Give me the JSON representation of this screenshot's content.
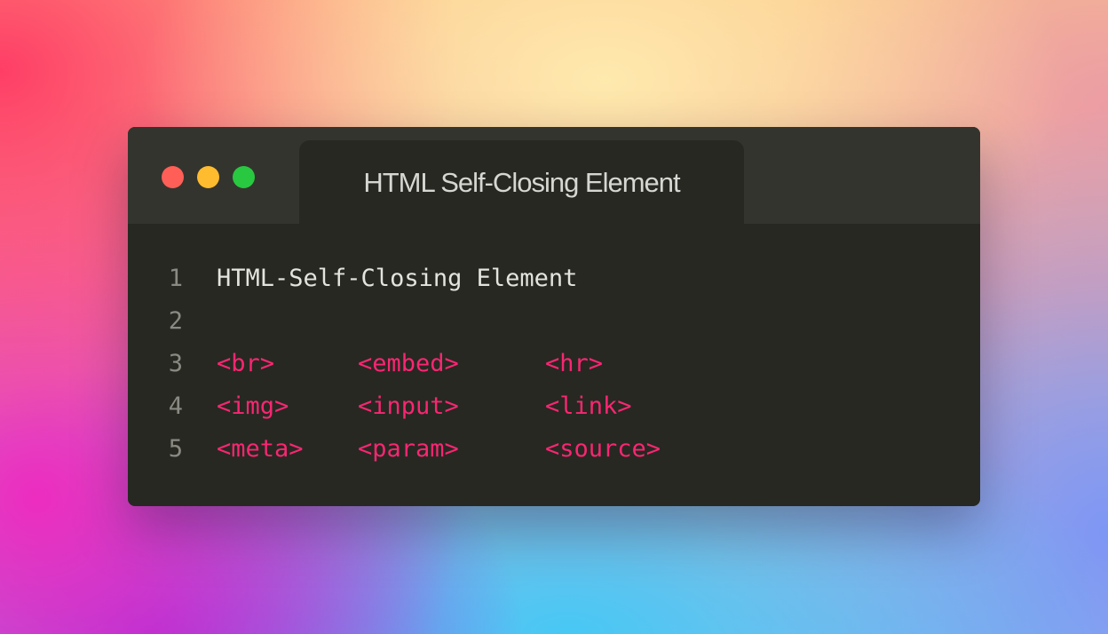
{
  "window": {
    "controls": {
      "close": "close",
      "minimize": "minimize",
      "maximize": "maximize",
      "colors": {
        "close": "#ff5f57",
        "minimize": "#febc2e",
        "maximize": "#28c840"
      }
    },
    "tab": {
      "title": "HTML Self-Closing Element"
    }
  },
  "editor": {
    "colors": {
      "background": "#272822",
      "tag": "#f92672",
      "text": "#e4e4de",
      "line_number": "#8a8a82"
    },
    "lines": [
      {
        "number": "1",
        "text": "HTML-Self-Closing Element"
      },
      {
        "number": "2",
        "text": ""
      },
      {
        "number": "3",
        "tags": [
          "<br>",
          "<embed>",
          "<hr>"
        ]
      },
      {
        "number": "4",
        "tags": [
          "<img>",
          "<input>",
          "<link>"
        ]
      },
      {
        "number": "5",
        "tags": [
          "<meta>",
          "<param>",
          "<source>"
        ]
      }
    ]
  }
}
